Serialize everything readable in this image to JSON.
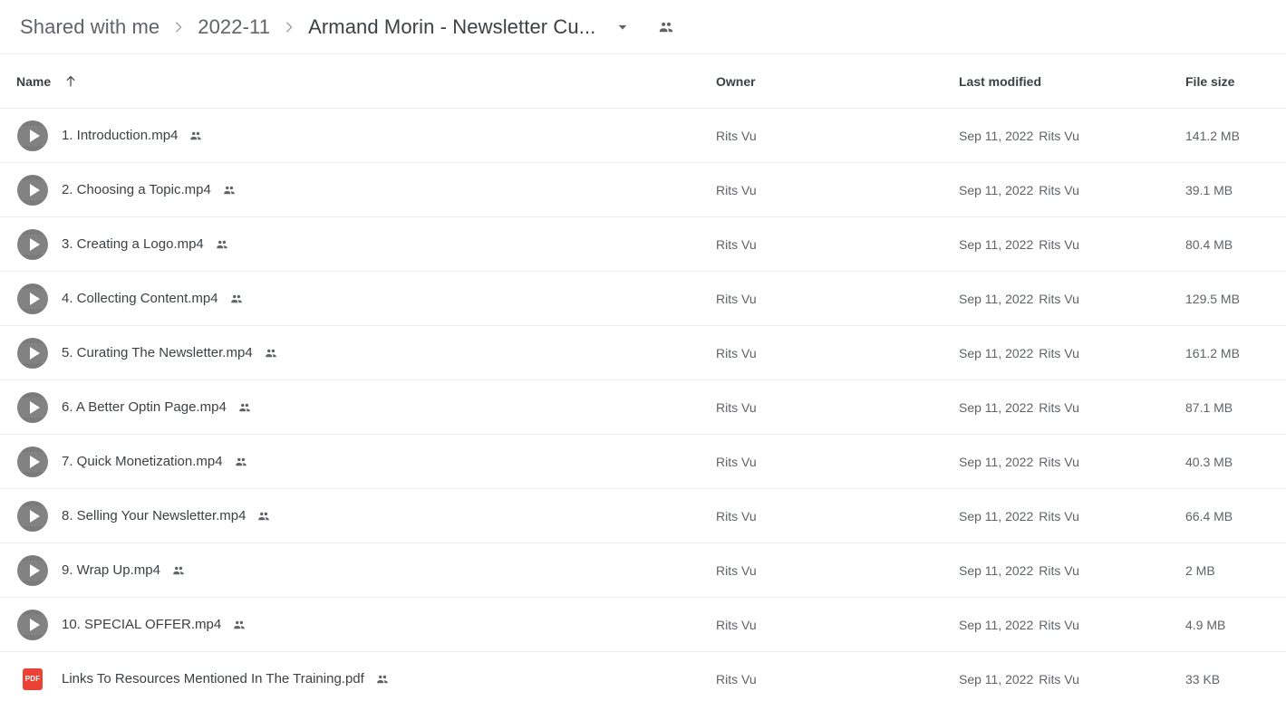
{
  "breadcrumb": {
    "items": [
      {
        "label": "Shared with me",
        "current": false
      },
      {
        "label": "2022-11",
        "current": false
      },
      {
        "label": "Armand Morin - Newsletter Cu...",
        "current": true
      }
    ],
    "caret_icon": "chevron-down-icon",
    "shared_icon": "people-icon",
    "separator_icon": "chevron-right-icon"
  },
  "columns": {
    "name": "Name",
    "owner": "Owner",
    "modified": "Last modified",
    "size": "File size",
    "sort_icon": "arrow-up-icon",
    "sort_direction": "ascending"
  },
  "colors": {
    "pdf_red": "#ea4335",
    "video_gray": "#7b7b7b",
    "divider": "#e8eaed",
    "text_primary": "#3c4043",
    "text_secondary": "#5f6368"
  },
  "files": [
    {
      "name": "1. Introduction.mp4",
      "icon": "video-thumbnail-icon",
      "badge": "",
      "shared": true,
      "owner": "Rits Vu",
      "modified_date": "Sep 11, 2022",
      "modified_by": "Rits Vu",
      "size": "141.2 MB"
    },
    {
      "name": "2. Choosing a Topic.mp4",
      "icon": "video-thumbnail-icon",
      "badge": "",
      "shared": true,
      "owner": "Rits Vu",
      "modified_date": "Sep 11, 2022",
      "modified_by": "Rits Vu",
      "size": "39.1 MB"
    },
    {
      "name": "3. Creating a Logo.mp4",
      "icon": "video-thumbnail-icon",
      "badge": "",
      "shared": true,
      "owner": "Rits Vu",
      "modified_date": "Sep 11, 2022",
      "modified_by": "Rits Vu",
      "size": "80.4 MB"
    },
    {
      "name": "4. Collecting Content.mp4",
      "icon": "video-thumbnail-icon",
      "badge": "",
      "shared": true,
      "owner": "Rits Vu",
      "modified_date": "Sep 11, 2022",
      "modified_by": "Rits Vu",
      "size": "129.5 MB"
    },
    {
      "name": "5. Curating The Newsletter.mp4",
      "icon": "video-thumbnail-icon",
      "badge": "",
      "shared": true,
      "owner": "Rits Vu",
      "modified_date": "Sep 11, 2022",
      "modified_by": "Rits Vu",
      "size": "161.2 MB"
    },
    {
      "name": "6. A Better Optin Page.mp4",
      "icon": "video-thumbnail-icon",
      "badge": "",
      "shared": true,
      "owner": "Rits Vu",
      "modified_date": "Sep 11, 2022",
      "modified_by": "Rits Vu",
      "size": "87.1 MB"
    },
    {
      "name": "7. Quick Monetization.mp4",
      "icon": "video-thumbnail-icon",
      "badge": "",
      "shared": true,
      "owner": "Rits Vu",
      "modified_date": "Sep 11, 2022",
      "modified_by": "Rits Vu",
      "size": "40.3 MB"
    },
    {
      "name": "8. Selling Your Newsletter.mp4",
      "icon": "video-thumbnail-icon",
      "badge": "",
      "shared": true,
      "owner": "Rits Vu",
      "modified_date": "Sep 11, 2022",
      "modified_by": "Rits Vu",
      "size": "66.4 MB"
    },
    {
      "name": "9. Wrap Up.mp4",
      "icon": "video-thumbnail-icon",
      "badge": "",
      "shared": true,
      "owner": "Rits Vu",
      "modified_date": "Sep 11, 2022",
      "modified_by": "Rits Vu",
      "size": "2 MB"
    },
    {
      "name": "10. SPECIAL OFFER.mp4",
      "icon": "video-thumbnail-icon",
      "badge": "",
      "shared": true,
      "owner": "Rits Vu",
      "modified_date": "Sep 11, 2022",
      "modified_by": "Rits Vu",
      "size": "4.9 MB"
    },
    {
      "name": "Links To Resources Mentioned In The Training.pdf",
      "icon": "pdf-file-icon",
      "badge": "PDF",
      "shared": true,
      "owner": "Rits Vu",
      "modified_date": "Sep 11, 2022",
      "modified_by": "Rits Vu",
      "size": "33 KB"
    }
  ]
}
